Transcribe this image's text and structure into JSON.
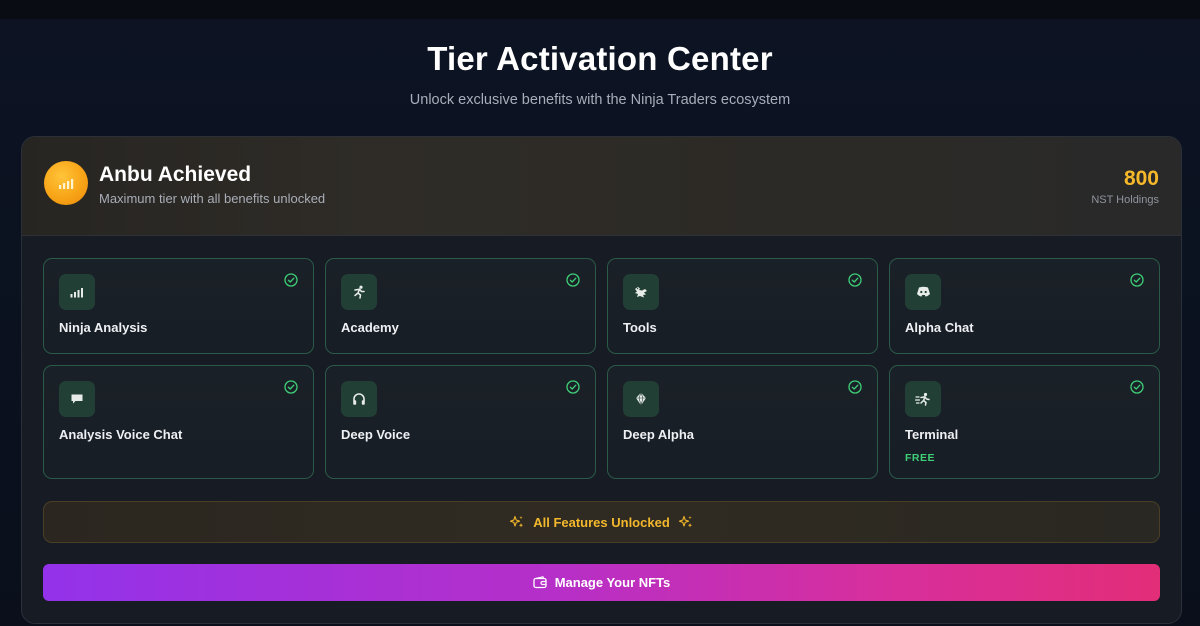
{
  "header": {
    "title": "Tier Activation Center",
    "subtitle": "Unlock exclusive benefits with the Ninja Traders ecosystem"
  },
  "tier": {
    "name": "Anbu Achieved",
    "description": "Maximum tier with all benefits unlocked",
    "holdings_value": "800",
    "holdings_label": "NST Holdings",
    "badge_icon": "bar-chart-icon"
  },
  "features": [
    {
      "label": "Ninja Analysis",
      "icon": "bar-chart-icon",
      "unlocked": true
    },
    {
      "label": "Academy",
      "icon": "runner-icon",
      "unlocked": true
    },
    {
      "label": "Tools",
      "icon": "dragon-icon",
      "unlocked": true
    },
    {
      "label": "Alpha Chat",
      "icon": "discord-icon",
      "unlocked": true
    },
    {
      "label": "Analysis Voice Chat",
      "icon": "chat-bubble-icon",
      "unlocked": true
    },
    {
      "label": "Deep Voice",
      "icon": "headphones-icon",
      "unlocked": true
    },
    {
      "label": "Deep Alpha",
      "icon": "gem-icon",
      "unlocked": true
    },
    {
      "label": "Terminal",
      "icon": "dash-icon",
      "unlocked": true,
      "tag": "FREE"
    }
  ],
  "unlocked_banner": {
    "text": "All Features Unlocked",
    "icon": "sparkles-icon"
  },
  "manage_button": {
    "label": "Manage Your NFTs",
    "icon": "wallet-icon"
  },
  "colors": {
    "accent_gold": "#f5b82a",
    "accent_green": "#3ecf78",
    "card_border": "#2b5a48",
    "button_gradient_start": "#9332ea",
    "button_gradient_end": "#e22d78"
  }
}
